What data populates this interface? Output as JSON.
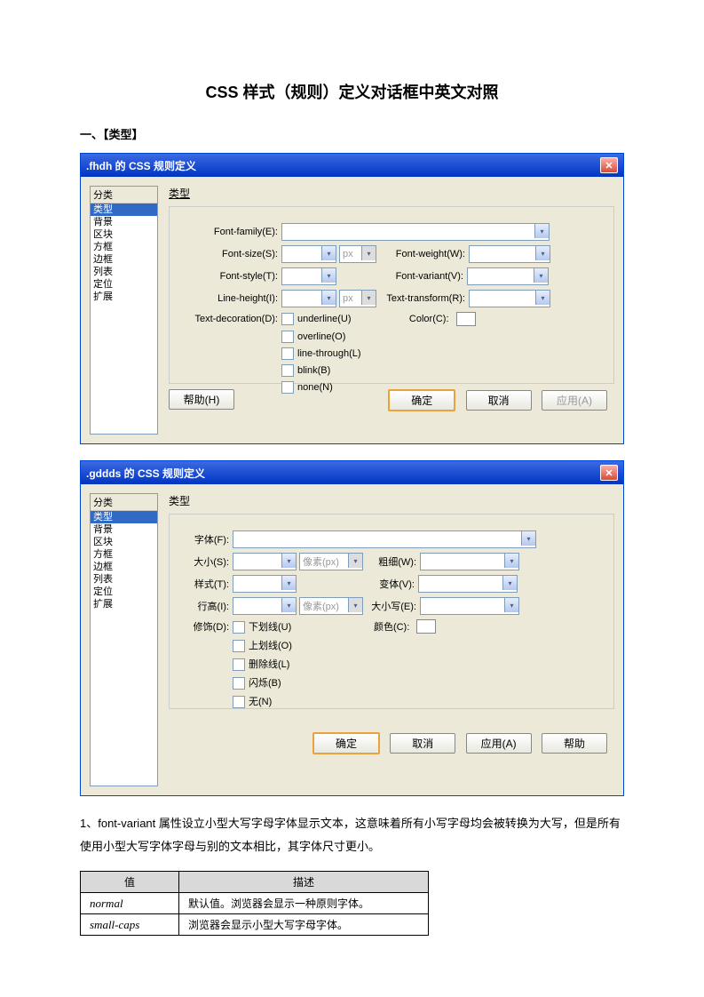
{
  "title": "CSS 样式（规则）定义对话框中英文对照",
  "section1": "一、【类型】",
  "dlg1": {
    "title": ".fhdh 的 CSS 规则定义",
    "sidebar_head": "分类",
    "sidebar": [
      "类型",
      "背景",
      "区块",
      "方框",
      "边框",
      "列表",
      "定位",
      "扩展"
    ],
    "panel": "类型",
    "labels": {
      "font_family": "Font-family(E):",
      "font_size": "Font-size(S):",
      "font_style": "Font-style(T):",
      "line_height": "Line-height(I):",
      "text_decoration": "Text-decoration(D):",
      "font_weight": "Font-weight(W):",
      "font_variant": "Font-variant(V):",
      "text_transform": "Text-transform(R):",
      "color": "Color(C):",
      "px1": "px",
      "px2": "px"
    },
    "checks": {
      "underline": "underline(U)",
      "overline": "overline(O)",
      "line_through": "line-through(L)",
      "blink": "blink(B)",
      "none": "none(N)"
    },
    "buttons": {
      "help": "帮助(H)",
      "ok": "确定",
      "cancel": "取消",
      "apply": "应用(A)"
    }
  },
  "dlg2": {
    "title": ".gddds 的 CSS 规则定义",
    "sidebar_head": "分类",
    "sidebar": [
      "类型",
      "背景",
      "区块",
      "方框",
      "边框",
      "列表",
      "定位",
      "扩展"
    ],
    "panel": "类型",
    "labels": {
      "font": "字体(F):",
      "size": "大小(S):",
      "style": "样式(T):",
      "line_height": "行高(I):",
      "decoration": "修饰(D):",
      "weight": "粗细(W):",
      "variant": "变体(V):",
      "case": "大小写(E):",
      "color": "颜色(C):",
      "px1": "像素(px)",
      "px2": "像素(px)"
    },
    "checks": {
      "underline": "下划线(U)",
      "overline": "上划线(O)",
      "strike": "删除线(L)",
      "blink": "闪烁(B)",
      "none": "无(N)"
    },
    "buttons": {
      "ok": "确定",
      "cancel": "取消",
      "apply": "应用(A)",
      "help": "帮助"
    }
  },
  "note": "1、font-variant 属性设立小型大写字母字体显示文本，这意味着所有小写字母均会被转换为大写，但是所有使用小型大写字体字母与别的文本相比，其字体尺寸更小。",
  "table": {
    "h1": "值",
    "h2": "描述",
    "r1c1": "normal",
    "r1c2": "默认值。浏览器会显示一种原则字体。",
    "r2c1": "small-caps",
    "r2c2": "浏览器会显示小型大写字母字体。"
  }
}
